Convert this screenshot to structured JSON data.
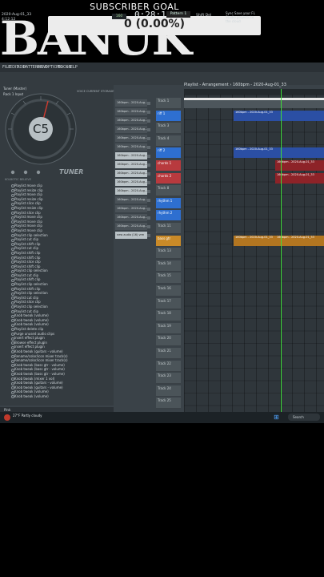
{
  "overlay": {
    "subscriber_label": "SUBSCRIBER GOAL",
    "goal_value": "0 (0.00%)",
    "big_title": "BANUK"
  },
  "menu": [
    "FILE",
    "EDIT",
    "ADD",
    "PATTERNS",
    "VIEW",
    "OPTIONS",
    "TOOLS",
    "HELP"
  ],
  "toolbar": {
    "time": "0:28:14",
    "pattern": "Pattern 1",
    "bpm": "160",
    "swing": "Shift  Del",
    "news": "Sync Save your FL Studio projects to the cloud",
    "project": "2020-Aug-01_33",
    "small": "4:12:12"
  },
  "tuner": {
    "header": "Tuner (Master)",
    "subheader": "Rack 1 Input",
    "note": "C5",
    "label": "TUNER",
    "brand": "KOLBOTIC  BELIEVE",
    "tabs": "VOICE  CURRENT  STORAGE"
  },
  "browser": [
    "Playlist move clip",
    "Playlist resize clip",
    "Playlist move clip",
    "Playlist resize clip",
    "Playlist slice clip",
    "Playlist resize clip",
    "Playlist slice clip",
    "Playlist move clip",
    "Playlist move clip",
    "Playlist move clip",
    "Playlist move clip",
    "Playlist clip selection",
    "Playlist cut clip",
    "Playlist shift clip",
    "Playlist cut clip",
    "Playlist shift clip",
    "Playlist shift clip",
    "Playlist slice clip",
    "Playlist shift clip",
    "Playlist clip selection",
    "Playlist cut clip",
    "Playlist shift clip",
    "Playlist clip selection",
    "Playlist shift clip",
    "Playlist clip selection",
    "Playlist cut clip",
    "Playlist slice clip",
    "Playlist clip selection",
    "Playlist cut clip",
    "Knob tweak (volume)",
    "Knob tweak (volume)",
    "Knob tweak (volume)",
    "Playlist delete clip",
    "Purge unused audio clips",
    "Insert effect plugin",
    "Browse effect plugin",
    "Insert effect plugin",
    "Knob tweak (guitars - volume)",
    "Rename/color/icon mixer track(s)",
    "Rename/color/icon mixer track(s)",
    "Knob tweak (bass gtr - volume)",
    "Knob tweak (bass gtr - volume)",
    "Knob tweak (bass gtr - volume)",
    "Knob tweak (mixer 1 vol)",
    "Knob tweak (guitars - volume)",
    "Knob tweak (guitars - volume)",
    "Knob tweak (volume)",
    "Knob tweak (volume)"
  ],
  "browser_footer": "Pink",
  "channels": [
    {
      "label": "160bpm - 2020-Aug...",
      "light": false
    },
    {
      "label": "160bpm - 2020-Aug...",
      "light": false
    },
    {
      "label": "160bpm - 2020-Aug...",
      "light": false
    },
    {
      "label": "160bpm - 2020-Aug...",
      "light": false
    },
    {
      "label": "160bpm - 2020-Aug...",
      "light": false
    },
    {
      "label": "160bpm - 2020-Aug...",
      "light": false
    },
    {
      "label": "160bpm - 2020-Aug...",
      "light": true
    },
    {
      "label": "160bpm - 2020-Aug...",
      "light": true
    },
    {
      "label": "160bpm - 2020-Aug...",
      "light": true
    },
    {
      "label": "160bpm - 2020-Aug...",
      "light": true
    },
    {
      "label": "160bpm - 2020-Aug...",
      "light": true
    },
    {
      "label": "160bpm - 2020-Aug...",
      "light": false
    },
    {
      "label": "160bpm - 2020-Aug...",
      "light": false
    },
    {
      "label": "160bpm - 2020-Aug...",
      "light": false
    },
    {
      "label": "160bpm - 2020-Aug...",
      "light": false
    },
    {
      "label": "new audio (16) vrm",
      "light": true
    }
  ],
  "playlist_title": "Playlist - Arrangement › 160bpm - 2020-Aug-01_33",
  "tracks": [
    {
      "label": "Track 1",
      "color": ""
    },
    {
      "label": "riff 1",
      "color": "blue"
    },
    {
      "label": "Track 3",
      "color": ""
    },
    {
      "label": "Track 4",
      "color": ""
    },
    {
      "label": "riff 2",
      "color": "blue"
    },
    {
      "label": "chords 1",
      "color": "red"
    },
    {
      "label": "chords 2",
      "color": "red"
    },
    {
      "label": "Track 8",
      "color": ""
    },
    {
      "label": "rhythm 1",
      "color": "blue"
    },
    {
      "label": "rhythm 2",
      "color": "blue"
    },
    {
      "label": "Track 11",
      "color": ""
    },
    {
      "label": "bass gtr",
      "color": "orange"
    },
    {
      "label": "Track 13",
      "color": ""
    },
    {
      "label": "Track 14",
      "color": ""
    },
    {
      "label": "Track 15",
      "color": ""
    },
    {
      "label": "Track 16",
      "color": ""
    },
    {
      "label": "Track 17",
      "color": ""
    },
    {
      "label": "Track 18",
      "color": ""
    },
    {
      "label": "Track 19",
      "color": ""
    },
    {
      "label": "Track 20",
      "color": ""
    },
    {
      "label": "Track 21",
      "color": ""
    },
    {
      "label": "Track 22",
      "color": ""
    },
    {
      "label": "Track 23",
      "color": ""
    },
    {
      "label": "Track 24",
      "color": ""
    },
    {
      "label": "Track 25",
      "color": ""
    }
  ],
  "clips": [
    {
      "label": "",
      "color": "white"
    },
    {
      "label": "160bpm - 2020-Aug-01_33",
      "color": "blue"
    },
    {
      "label": "160bpm - 2020-Aug-01_33",
      "color": "blue"
    },
    {
      "label": "160bpm - 2020-Aug-01_33",
      "color": "red"
    },
    {
      "label": "160bpm - 2020-Aug-01_33",
      "color": "red"
    },
    {
      "label": "160bpm - 2020-Aug-01_33",
      "color": "orange"
    },
    {
      "label": "160bpm - 2020-Aug-01_33",
      "color": "orange"
    }
  ],
  "taskbar": {
    "user": "27°F  Partly cloudy",
    "search": "Search"
  }
}
